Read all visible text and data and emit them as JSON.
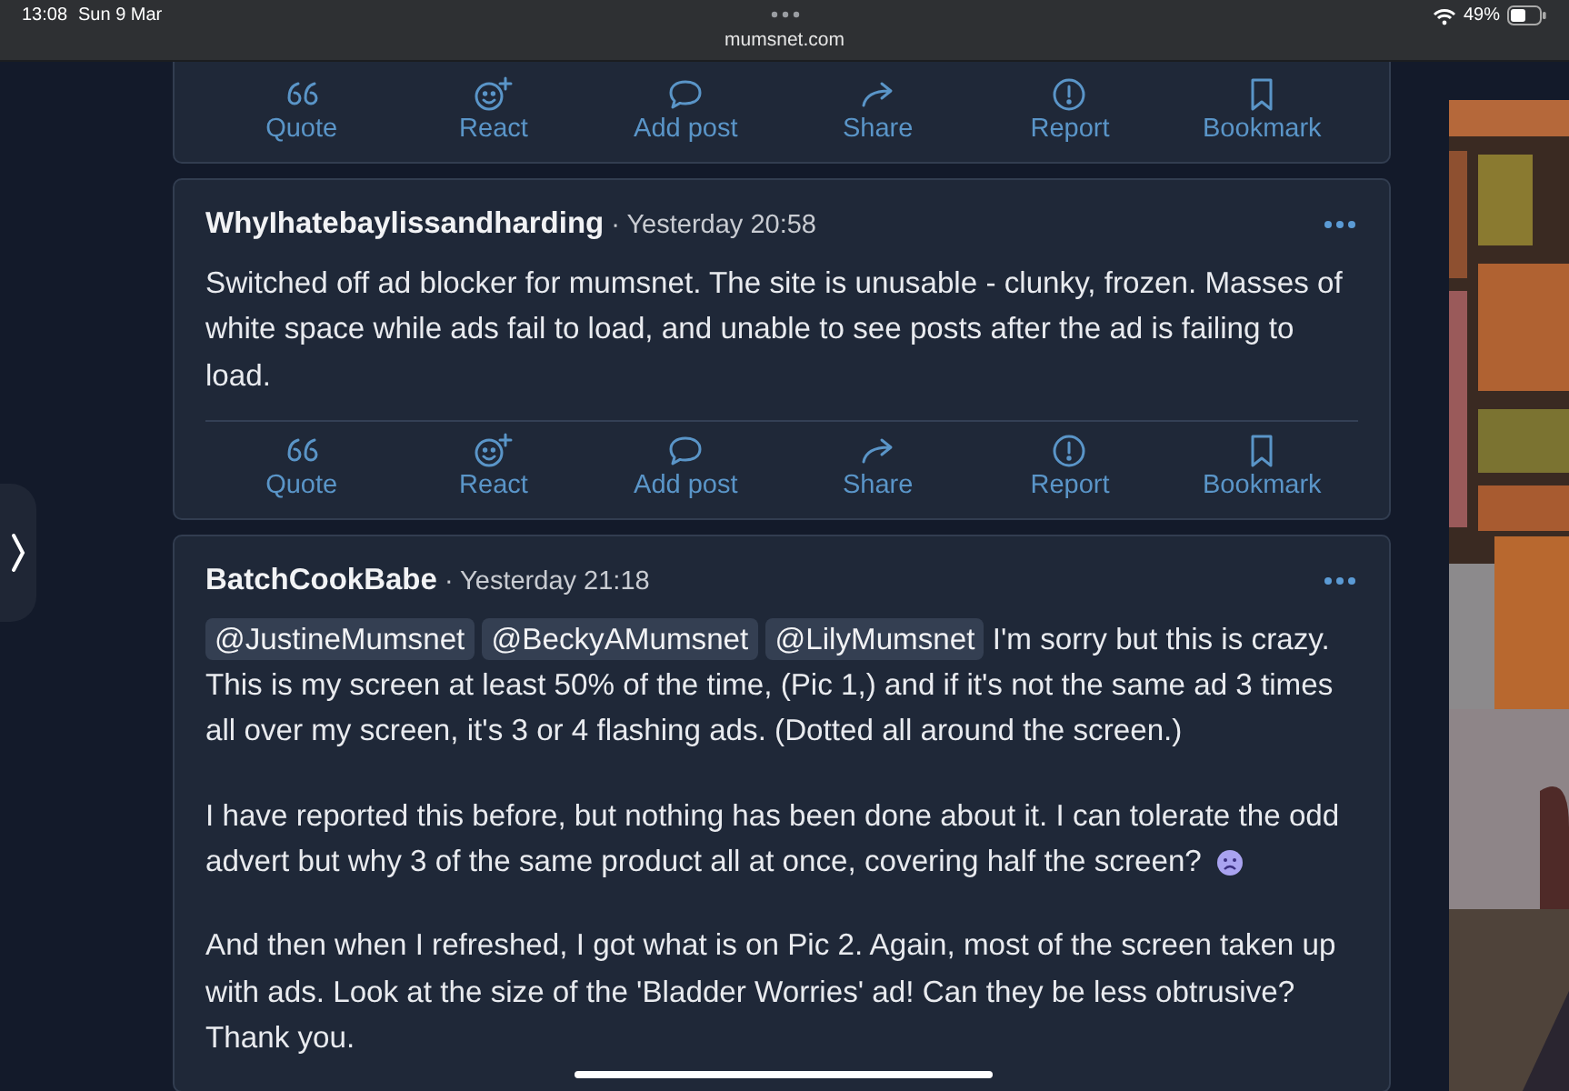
{
  "status_bar": {
    "time": "13:08",
    "date": "Sun 9 Mar",
    "battery": "49%"
  },
  "address_bar": {
    "url": "mumsnet.com"
  },
  "posts": [
    {
      "actions": [
        {
          "kind": "quote",
          "label": "Quote"
        },
        {
          "kind": "react",
          "label": "React"
        },
        {
          "kind": "reply",
          "label": "Add post"
        },
        {
          "kind": "share",
          "label": "Share"
        },
        {
          "kind": "report",
          "label": "Report"
        },
        {
          "kind": "bookmark",
          "label": "Bookmark"
        }
      ]
    },
    {
      "author": "WhyIhatebaylissandharding",
      "time": "· Yesterday 20:58",
      "paragraphs": [
        [
          {
            "kind": "text",
            "text": "Switched off ad blocker for mumsnet. The site is unusable - clunky, frozen. Masses of white space while ads fail to load, and unable to see posts after the ad is failing to load."
          }
        ]
      ],
      "actions": [
        {
          "kind": "quote",
          "label": "Quote"
        },
        {
          "kind": "react",
          "label": "React"
        },
        {
          "kind": "reply",
          "label": "Add post"
        },
        {
          "kind": "share",
          "label": "Share"
        },
        {
          "kind": "report",
          "label": "Report"
        },
        {
          "kind": "bookmark",
          "label": "Bookmark"
        }
      ]
    },
    {
      "author": "BatchCookBabe",
      "time": "· Yesterday 21:18",
      "paragraphs": [
        [
          {
            "kind": "mention",
            "text": "@JustineMumsnet"
          },
          {
            "kind": "mention",
            "text": "@BeckyAMumsnet"
          },
          {
            "kind": "mention",
            "text": "@LilyMumsnet"
          },
          {
            "kind": "text",
            "text": "I'm sorry but this is crazy. This is my screen at least 50% of the time, (Pic 1,) and if it's not the same ad 3 times all over my screen, it's 3 or 4 flashing ads. (Dotted all around the screen.)"
          }
        ],
        [
          {
            "kind": "text",
            "text": "I have reported this before, but nothing has been done about it. I can tolerate the odd advert but why 3 of the same product all at once, covering half the screen?"
          },
          {
            "kind": "emoji"
          }
        ],
        [
          {
            "kind": "text",
            "text": "And then when I refreshed, I got what is on Pic 2. Again, most of the screen taken up with ads. Look at the size of the 'Bladder Worries' ad! Can they be less obtrusive? Thank you."
          }
        ]
      ]
    }
  ]
}
